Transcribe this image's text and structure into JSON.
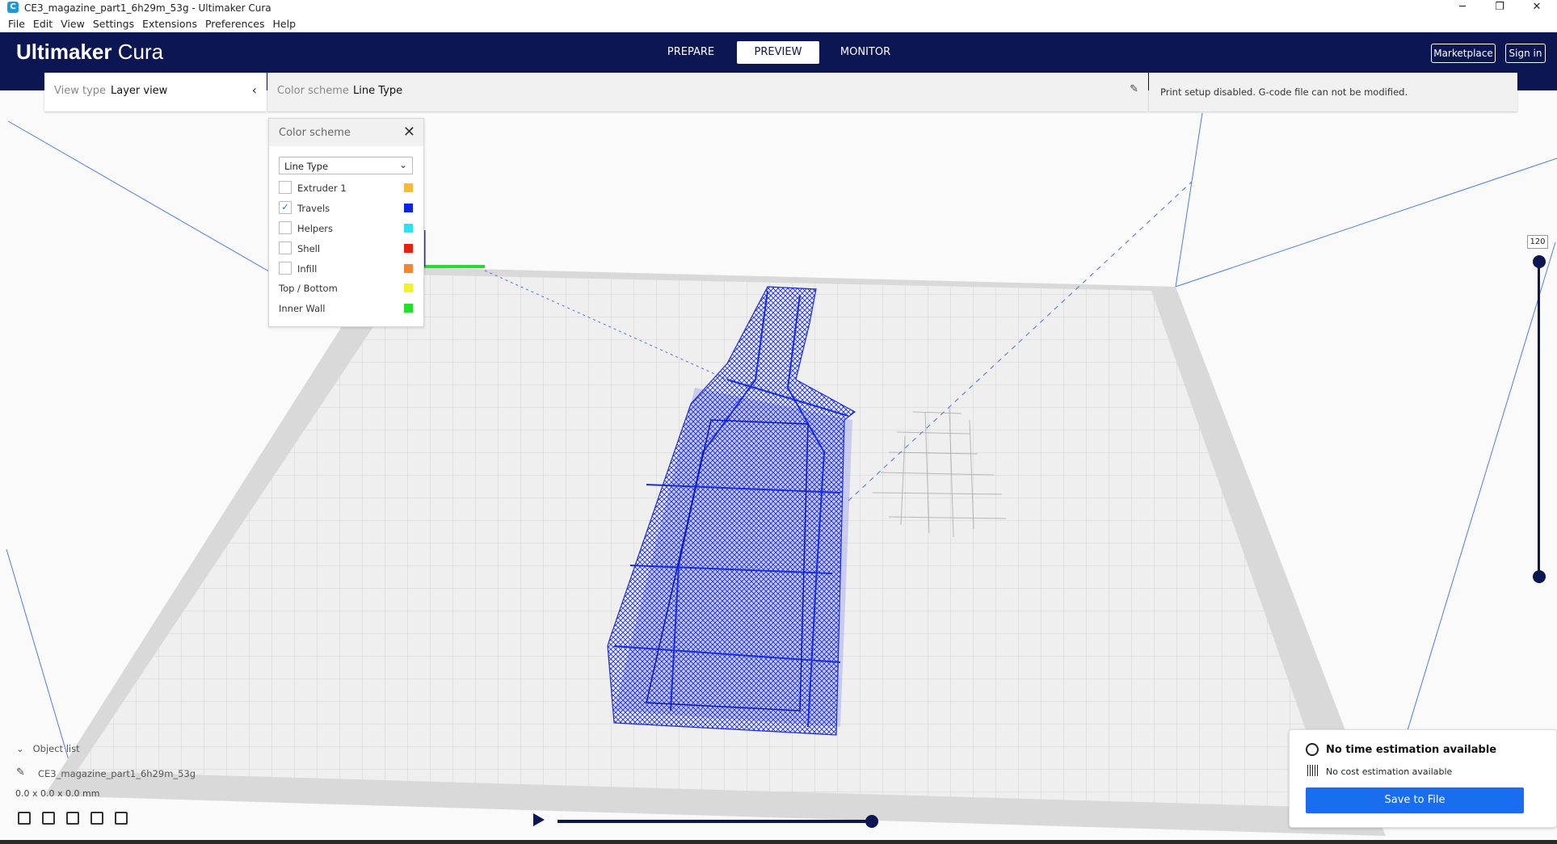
{
  "window": {
    "title": "CE3_magazine_part1_6h29m_53g - Ultimaker Cura",
    "minimize": "─",
    "restore": "❐",
    "close": "✕"
  },
  "menu": [
    "File",
    "Edit",
    "View",
    "Settings",
    "Extensions",
    "Preferences",
    "Help"
  ],
  "header": {
    "logo_bold": "Ultimaker",
    "logo_light": " Cura",
    "stages": [
      "PREPARE",
      "PREVIEW",
      "MONITOR"
    ],
    "active_stage": "PREVIEW",
    "marketplace": "Marketplace",
    "signin": "Sign in"
  },
  "view_type": {
    "label": "View type",
    "value": "Layer view"
  },
  "color_scheme_bar": {
    "label": "Color scheme",
    "value": "Line Type"
  },
  "print_setup": "Print setup disabled. G-code file can not be modified.",
  "popup": {
    "title": "Color scheme",
    "selected": "Line Type",
    "checkbox_items": [
      {
        "label": "Extruder 1",
        "checked": false,
        "color": "#f8b934"
      },
      {
        "label": "Travels",
        "checked": true,
        "color": "#0a24e8"
      },
      {
        "label": "Helpers",
        "checked": false,
        "color": "#29e4f2"
      },
      {
        "label": "Shell",
        "checked": false,
        "color": "#e82010"
      },
      {
        "label": "Infill",
        "checked": false,
        "color": "#f6852b"
      }
    ],
    "legend_items": [
      {
        "label": "Top / Bottom",
        "color": "#f2f22a"
      },
      {
        "label": "Inner Wall",
        "color": "#22e02a"
      }
    ]
  },
  "layer_slider": {
    "current": "120"
  },
  "object_list": {
    "label": "Object list",
    "object_name": "CE3_magazine_part1_6h29m_53g",
    "dimensions": "0.0 x 0.0 x 0.0 mm"
  },
  "estimation": {
    "time": "No time estimation available",
    "cost": "No cost estimation available",
    "save": "Save to File"
  },
  "colors": {
    "header": "#0c1652",
    "accent": "#196ef0",
    "travel": "#0a24e8"
  }
}
